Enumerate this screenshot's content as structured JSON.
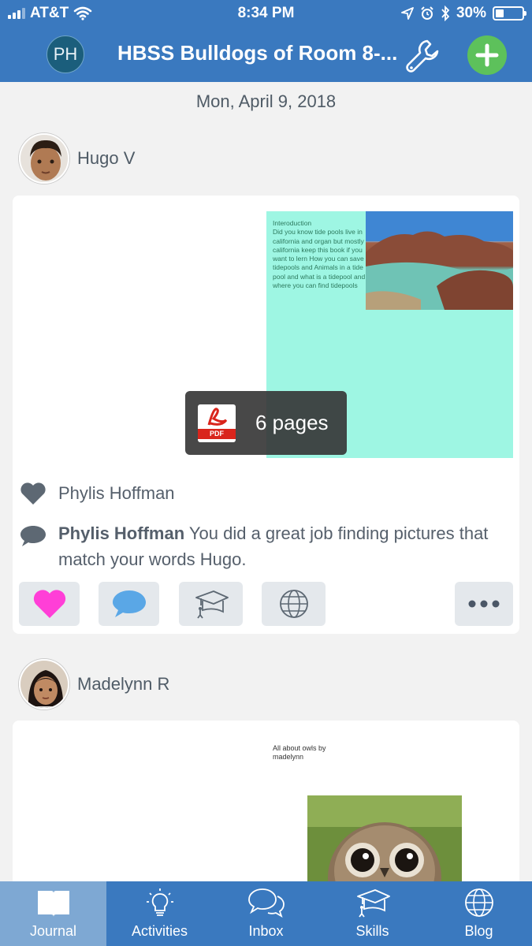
{
  "status_bar": {
    "carrier": "AT&T",
    "time": "8:34 PM",
    "battery": "30%",
    "battery_fraction": 0.3
  },
  "header": {
    "avatar_initials": "PH",
    "title": "HBSS Bulldogs of Room 8-..."
  },
  "date": "Mon, April 9, 2018",
  "posts": [
    {
      "student": "Hugo V",
      "pdf_text": "Interoduction\nDid you know tide pools live in california and organ but mostly california keep this book if you want to lern How you can save tidepools and Animals in a tide pool and what is a tidepool and where you can find tidepools",
      "pdf_icon_label": "PDF",
      "pages_label": "6 pages",
      "likes": "Phylis Hoffman",
      "comment": {
        "author": "Phylis Hoffman",
        "text": "You did a great job finding pictures that match your words Hugo."
      }
    },
    {
      "student": "Madelynn R",
      "pdf_text": "All about owls by madelynn"
    }
  ],
  "colors": {
    "brand_blue": "#3a79bf",
    "add_green": "#5dc15b",
    "like_pink": "#ff3fd7",
    "comment_blue": "#5aa7e6",
    "pdf_bg": "#9ef6e3"
  },
  "icons": [
    "wrench-icon",
    "plus-icon",
    "heart-icon",
    "speech-bubble-icon",
    "graduation-cap-icon",
    "globe-icon",
    "more-icon",
    "book-icon",
    "lightbulb-icon"
  ],
  "tabs": [
    {
      "label": "Journal",
      "active": true
    },
    {
      "label": "Activities"
    },
    {
      "label": "Inbox"
    },
    {
      "label": "Skills"
    },
    {
      "label": "Blog"
    }
  ]
}
